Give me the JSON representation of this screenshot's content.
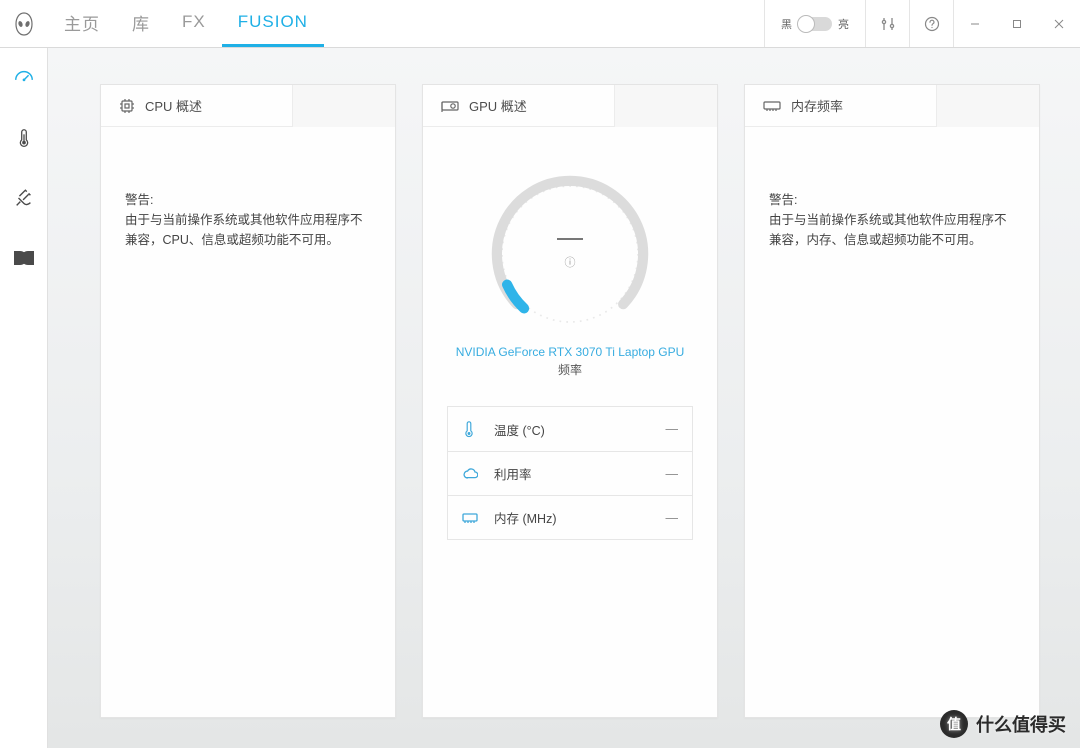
{
  "nav": {
    "items": [
      "主页",
      "库",
      "FX",
      "FUSION"
    ],
    "active_index": 3
  },
  "titlebar": {
    "theme_dark_label": "黑",
    "theme_light_label": "亮"
  },
  "sidebar": {
    "items": [
      {
        "name": "overview",
        "active": true
      },
      {
        "name": "thermal",
        "active": false
      },
      {
        "name": "power",
        "active": false
      },
      {
        "name": "audio",
        "active": false
      }
    ]
  },
  "panels": {
    "cpu": {
      "title": "CPU 概述",
      "warning_label": "警告:",
      "warning_text": "由于与当前操作系统或其他软件应用程序不兼容，CPU、信息或超频功能不可用。"
    },
    "gpu": {
      "title": "GPU 概述",
      "gauge_value": "—",
      "device_name": "NVIDIA GeForce RTX 3070 Ti Laptop GPU",
      "subtitle": "频率",
      "stats": [
        {
          "icon": "thermometer",
          "label": "温度 (°C)",
          "value": "—"
        },
        {
          "icon": "cloud",
          "label": "利用率",
          "value": "—"
        },
        {
          "icon": "memory",
          "label": "内存 (MHz)",
          "value": "—"
        }
      ]
    },
    "memory": {
      "title": "内存频率",
      "warning_label": "警告:",
      "warning_text": "由于与当前操作系统或其他软件应用程序不兼容，内存、信息或超频功能不可用。"
    }
  },
  "watermark": {
    "badge": "值",
    "text": "什么值得买"
  }
}
